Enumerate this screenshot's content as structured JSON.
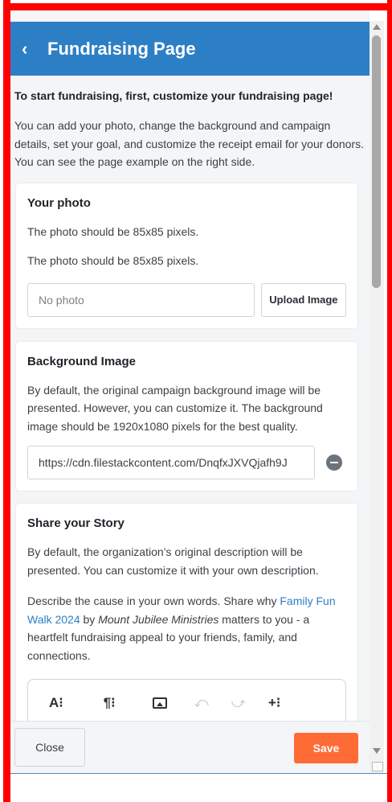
{
  "header": {
    "back_symbol": "‹",
    "title": "Fundraising Page"
  },
  "intro": {
    "heading": "To start fundraising, first, customize your fundraising page!",
    "body": "You can add your photo, change the background and campaign details, set your goal, and customize the receipt email for your donors. You can see the page example on the right side."
  },
  "photo_card": {
    "title": "Your photo",
    "text_1": "The photo should be 85x85 pixels.",
    "text_2": "The photo should be 85x85 pixels.",
    "input_placeholder": "No photo",
    "upload_label": "Upload Image"
  },
  "background_card": {
    "title": "Background Image",
    "text": "By default, the original campaign background image will be presented. However, you can customize it. The background image should be 1920x1080 pixels for the best quality.",
    "url_value": "https://cdn.filestackcontent.com/DnqfxJXVQjafh9J"
  },
  "story_card": {
    "title": "Share your Story",
    "text_1": "By default, the organization’s original description will be presented. You can customize it with your own description.",
    "text_2_prefix": "Describe the cause in your own words. Share why ",
    "campaign_link": "Family Fun Walk 2024",
    "text_2_by": " by ",
    "organization": "Mount Jubilee Ministries",
    "text_2_suffix": " matters to you - a heartfelt fundraising appeal to your friends, family, and connections.",
    "toolbar": {
      "font_tool": "A⁝",
      "paragraph_tool": "¶⁝",
      "undo": "⤺",
      "redo": "⤻",
      "insert_tool": "+⁝"
    }
  },
  "footer": {
    "close_label": "Close",
    "save_label": "Save"
  },
  "colors": {
    "header": "#2d7fc5",
    "save": "#ff6b35",
    "frame": "#ff0000"
  }
}
